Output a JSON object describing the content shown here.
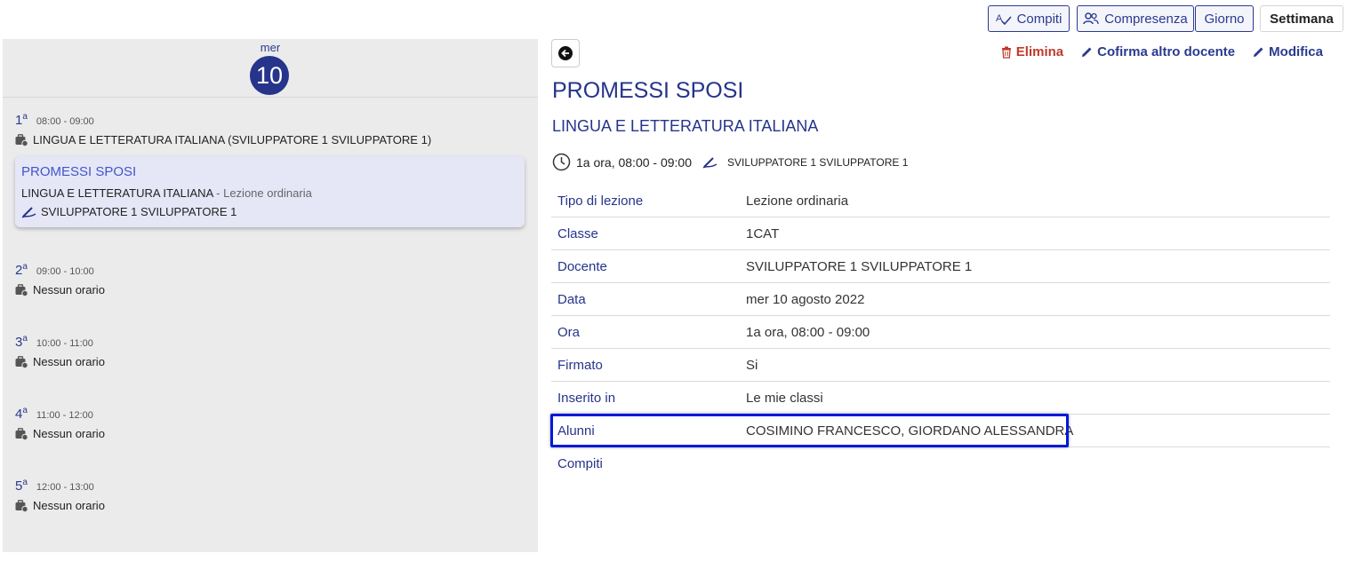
{
  "toolbar": {
    "compiti": "Compiti",
    "compresenza": "Compresenza",
    "giorno": "Giorno",
    "settimana": "Settimana"
  },
  "day": {
    "name": "mer",
    "number": "10"
  },
  "slots": [
    {
      "num": "1",
      "sup": "a",
      "time": "08:00 - 09:00",
      "line": "LINGUA E LETTERATURA ITALIANA (SVILUPPATORE 1 SVILUPPATORE 1)"
    },
    {
      "num": "2",
      "sup": "a",
      "time": "09:00 - 10:00",
      "line": "Nessun orario"
    },
    {
      "num": "3",
      "sup": "a",
      "time": "10:00 - 11:00",
      "line": "Nessun orario"
    },
    {
      "num": "4",
      "sup": "a",
      "time": "11:00 - 12:00",
      "line": "Nessun orario"
    },
    {
      "num": "5",
      "sup": "a",
      "time": "12:00 - 13:00",
      "line": "Nessun orario"
    }
  ],
  "lesson_card": {
    "title": "PROMESSI SPOSI",
    "subject": "LINGUA E LETTERATURA ITALIANA",
    "type": "- Lezione ordinaria",
    "teacher": "SVILUPPATORE 1 SVILUPPATORE 1"
  },
  "actions": {
    "elimina": "Elimina",
    "cofirma": "Cofirma altro docente",
    "modifica": "Modifica"
  },
  "detail": {
    "title": "PROMESSI SPOSI",
    "subject": "LINGUA E LETTERATURA ITALIANA",
    "time": "1a ora, 08:00 - 09:00",
    "teacher": "SVILUPPATORE 1 SVILUPPATORE 1",
    "rows": [
      {
        "key": "Tipo di lezione",
        "value": "Lezione ordinaria"
      },
      {
        "key": "Classe",
        "value": "1CAT"
      },
      {
        "key": "Docente",
        "value": "SVILUPPATORE 1 SVILUPPATORE 1"
      },
      {
        "key": "Data",
        "value": "mer 10 agosto 2022"
      },
      {
        "key": "Ora",
        "value": "1a ora, 08:00 - 09:00"
      },
      {
        "key": "Firmato",
        "value": "Si"
      },
      {
        "key": "Inserito in",
        "value": "Le mie classi"
      },
      {
        "key": "Alunni",
        "value": "COSIMINO FRANCESCO, GIORDANO ALESSANDRA"
      },
      {
        "key": "Compiti",
        "value": ""
      }
    ]
  },
  "colors": {
    "accent": "#26348b",
    "danger": "#c0392b",
    "card": "#e5e7f7",
    "highlight": "#0018d9"
  }
}
